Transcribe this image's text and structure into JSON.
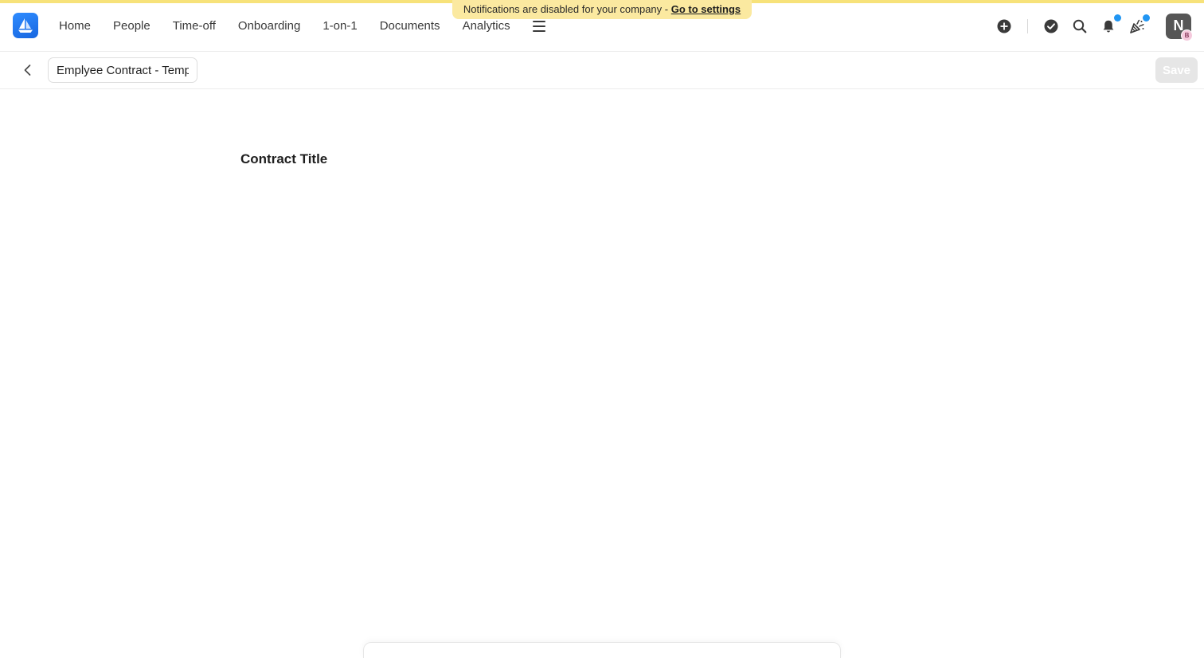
{
  "banner": {
    "message": "Notifications are disabled for your company - ",
    "link_label": "Go to settings"
  },
  "nav": {
    "items": [
      {
        "label": "Home"
      },
      {
        "label": "People"
      },
      {
        "label": "Time-off"
      },
      {
        "label": "Onboarding"
      },
      {
        "label": "1-on-1"
      },
      {
        "label": "Documents"
      },
      {
        "label": "Analytics"
      }
    ],
    "menu_icon": "hamburger-icon"
  },
  "header_icons": [
    "plus-circle-icon",
    "check-circle-icon",
    "search-icon",
    "bell-icon",
    "celebration-icon"
  ],
  "user": {
    "initial": "N",
    "badge": "B"
  },
  "editor": {
    "title_value": "Emplyee Contract - Template",
    "save_label": "Save",
    "content_heading": "Contract Title"
  },
  "colors": {
    "brand": "#1766e0",
    "banner_bg": "#fbe9a0",
    "notification_dot": "#2196f3",
    "save_disabled_bg": "#e6e6e6"
  }
}
